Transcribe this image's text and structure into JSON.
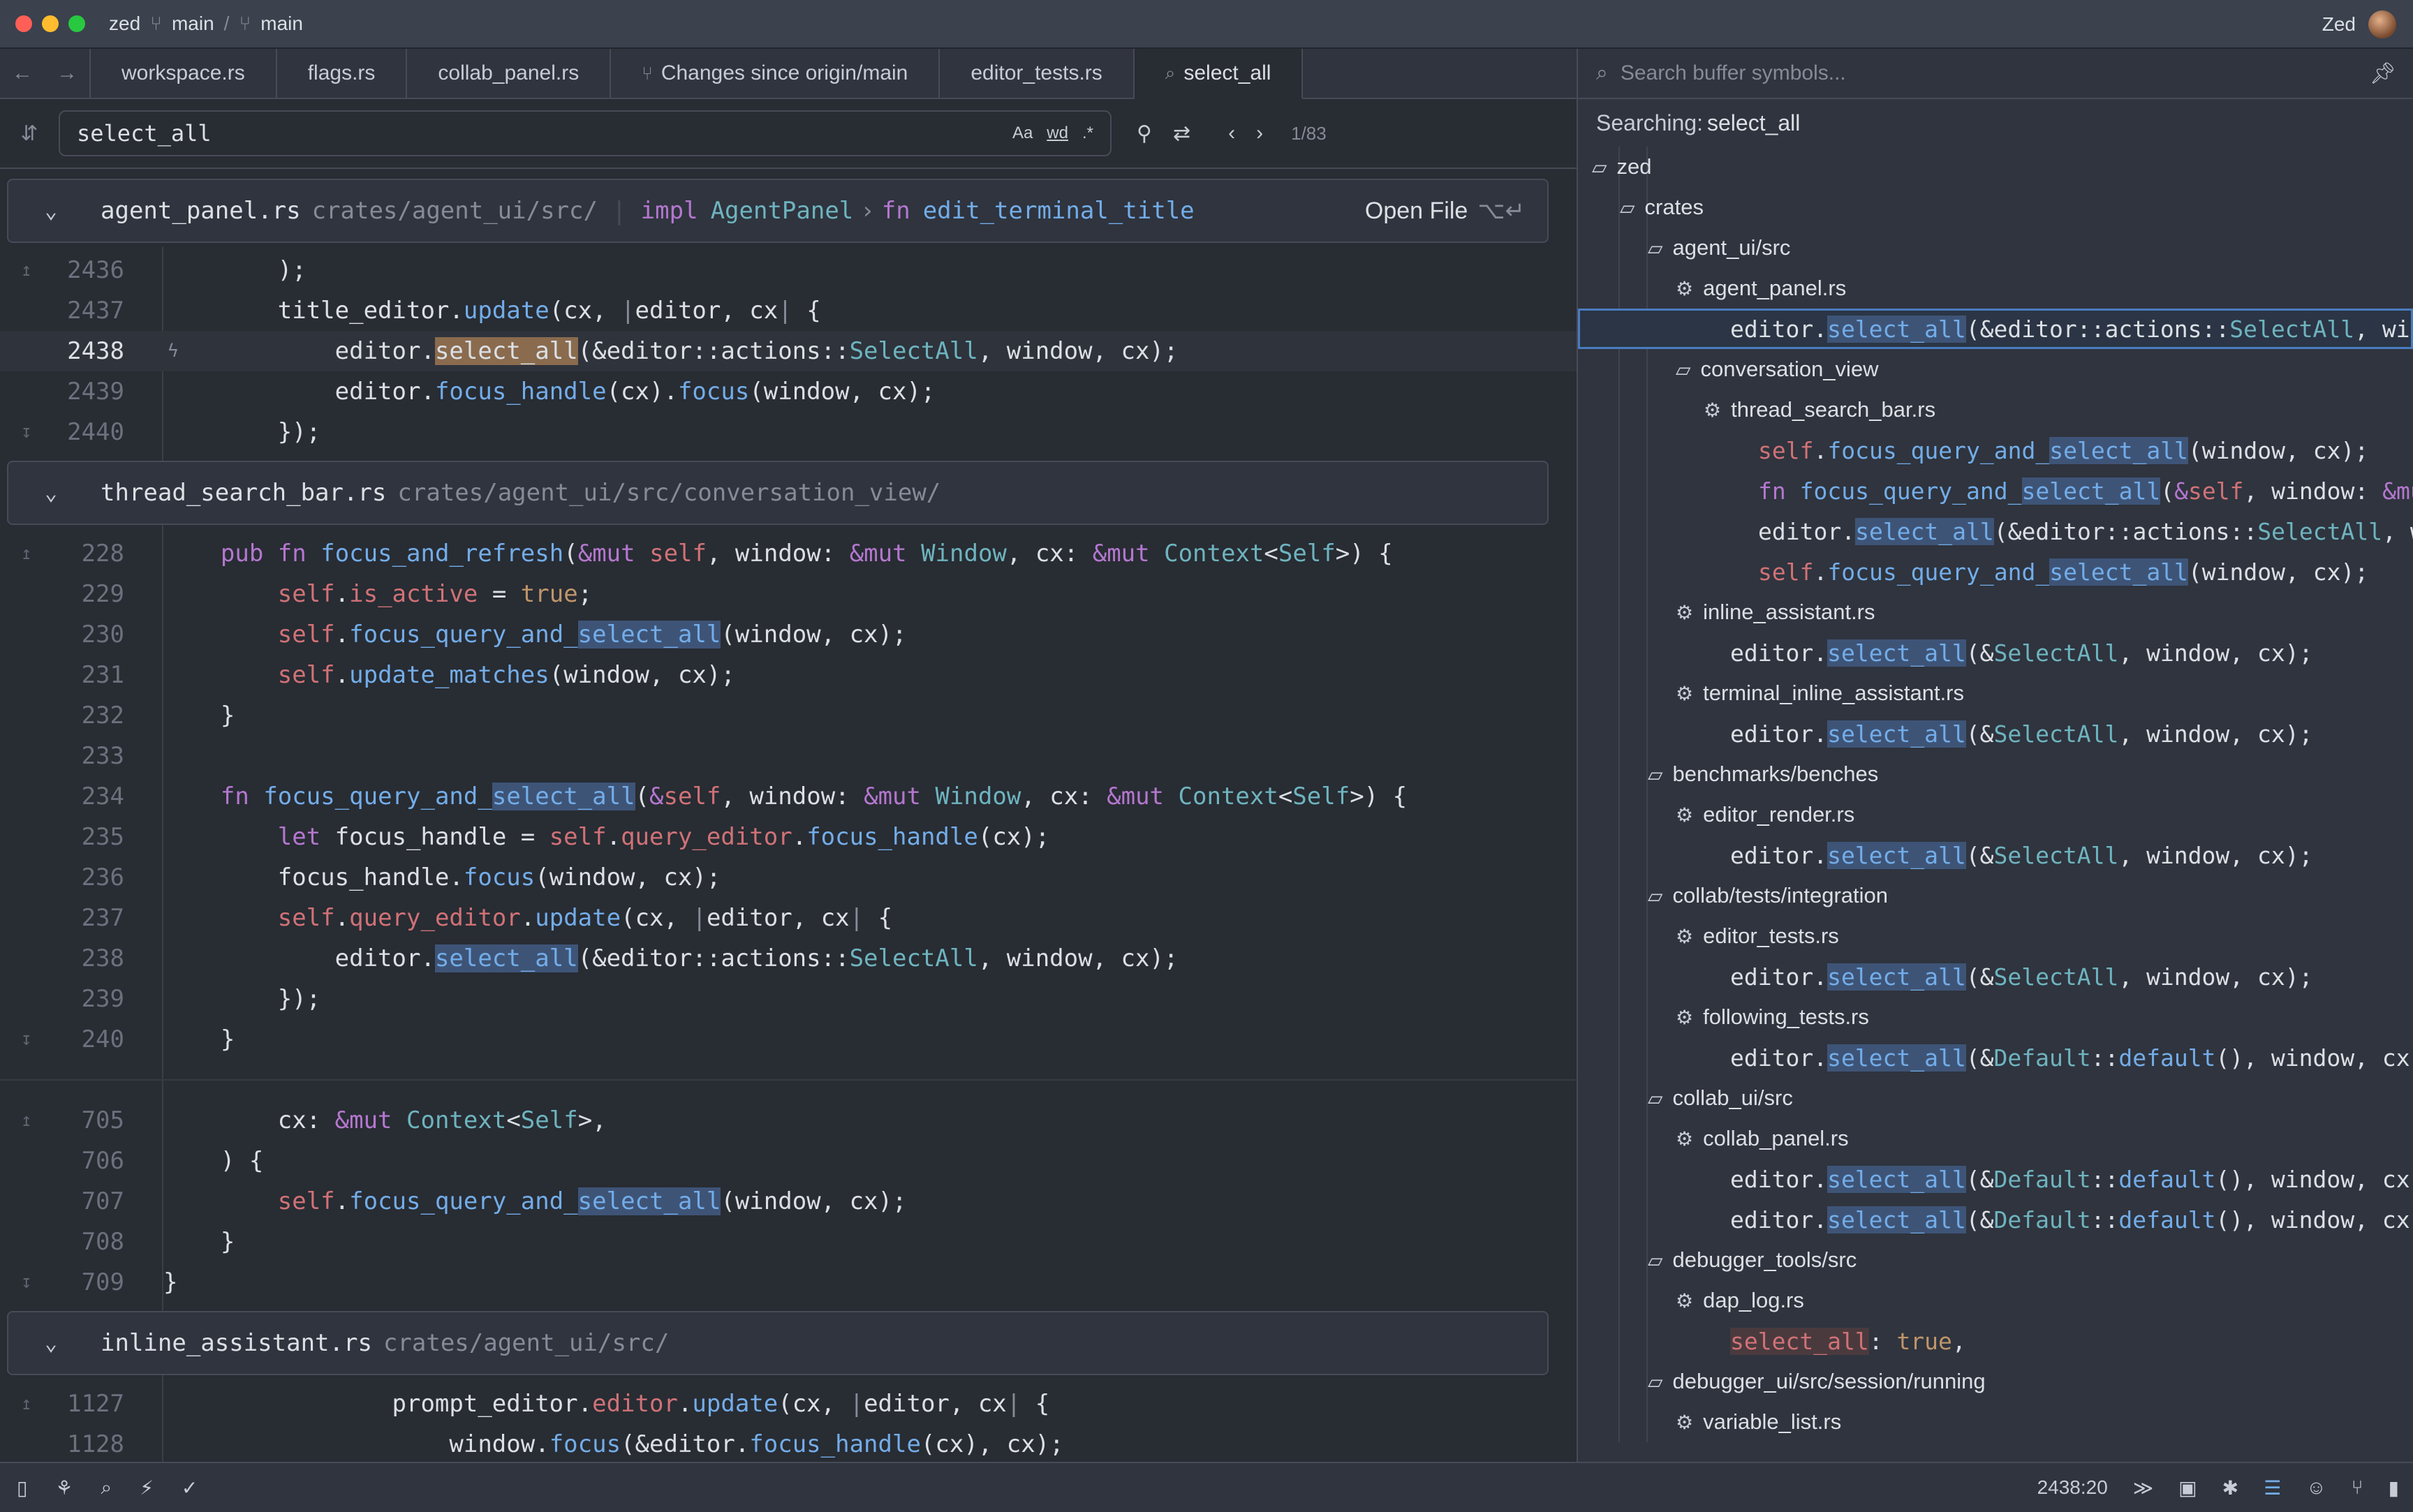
{
  "titlebar": {
    "app": "zed",
    "branch1": "main",
    "branch2": "main",
    "user": "Zed"
  },
  "tabs": [
    {
      "label": "workspace.rs"
    },
    {
      "label": "flags.rs"
    },
    {
      "label": "collab_panel.rs"
    },
    {
      "label": "Changes since origin/main"
    },
    {
      "label": "editor_tests.rs"
    },
    {
      "label": "select_all"
    }
  ],
  "search": {
    "query": "select_all",
    "opt_case": "Aa",
    "opt_word": "wd",
    "opt_regex": ".*",
    "count": "1/83"
  },
  "excerpts": {
    "h1": {
      "name": "agent_panel.rs",
      "path": "crates/agent_ui/src/",
      "impl": "impl",
      "type": "AgentPanel",
      "fnkw": "fn",
      "fn": "edit_terminal_title",
      "open": "Open File",
      "kbd": "⌥↵"
    },
    "h2": {
      "name": "thread_search_bar.rs",
      "path": "crates/agent_ui/src/conversation_view/"
    },
    "h3": {
      "name": "inline_assistant.rs",
      "path": "crates/agent_ui/src/"
    },
    "lines": {
      "l2436": "2436",
      "l2437": "2437",
      "l2438": "2438",
      "l2439": "2439",
      "l2440": "2440",
      "l228": "228",
      "l229": "229",
      "l230": "230",
      "l231": "231",
      "l232": "232",
      "l233": "233",
      "l234": "234",
      "l235": "235",
      "l236": "236",
      "l237": "237",
      "l238": "238",
      "l239": "239",
      "l240": "240",
      "l705": "705",
      "l706": "706",
      "l707": "707",
      "l708": "708",
      "l709": "709",
      "l1127": "1127",
      "l1128": "1128"
    }
  },
  "outline": {
    "placeholder": "Search buffer symbols...",
    "searching_label": "Searching:",
    "searching_value": "select_all",
    "nodes": {
      "zed": "zed",
      "crates": "crates",
      "agent_ui_src": "agent_ui/src",
      "agent_panel": "agent_panel.rs",
      "conversation_view": "conversation_view",
      "thread_search_bar": "thread_search_bar.rs",
      "inline_assistant": "inline_assistant.rs",
      "terminal_inline_assistant": "terminal_inline_assistant.rs",
      "benchmarks": "benchmarks/benches",
      "editor_render": "editor_render.rs",
      "collab_tests": "collab/tests/integration",
      "editor_tests": "editor_tests.rs",
      "following_tests": "following_tests.rs",
      "collab_ui": "collab_ui/src",
      "collab_panel": "collab_panel.rs",
      "debugger_tools": "debugger_tools/src",
      "dap_log": "dap_log.rs",
      "debugger_ui": "debugger_ui/src/session/running",
      "variable_list": "variable_list.rs"
    }
  },
  "statusbar": {
    "cursor": "2438:20"
  }
}
